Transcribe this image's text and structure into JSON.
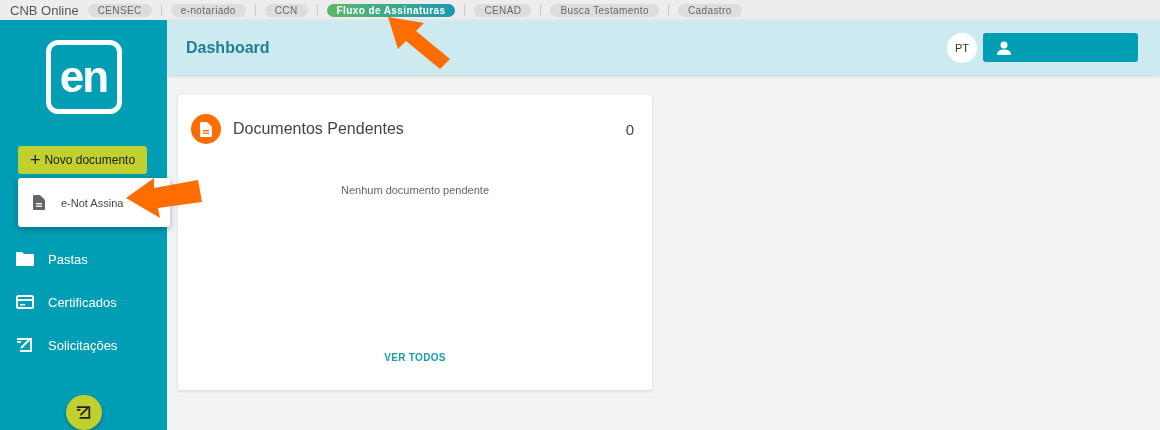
{
  "top_bar": {
    "brand": "CNB Online",
    "links": [
      {
        "label": "CENSEC",
        "selected": false
      },
      {
        "label": "e-notariado",
        "selected": false
      },
      {
        "label": "CCN",
        "selected": false
      },
      {
        "label": "Fluxo de Assinaturas",
        "selected": true
      },
      {
        "label": "CENAD",
        "selected": false
      },
      {
        "label": "Busca Testamento",
        "selected": false
      },
      {
        "label": "Cadastro",
        "selected": false
      }
    ]
  },
  "sidebar": {
    "logo": "en",
    "new_button": {
      "icon": "+",
      "label": "Novo documento"
    },
    "dropdown": {
      "items": [
        {
          "label": "e-Not Assina"
        }
      ]
    },
    "items": [
      {
        "label": "Pastas",
        "kind": "folder"
      },
      {
        "label": "Certificados",
        "kind": "card"
      },
      {
        "label": "Solicitações",
        "kind": "sign"
      }
    ]
  },
  "header": {
    "title": "Dashboard",
    "avatar": "PT"
  },
  "card": {
    "title": "Documentos Pendentes",
    "count": "0",
    "empty_message": "Nenhum documento pendente",
    "link": "VER TODOS"
  }
}
